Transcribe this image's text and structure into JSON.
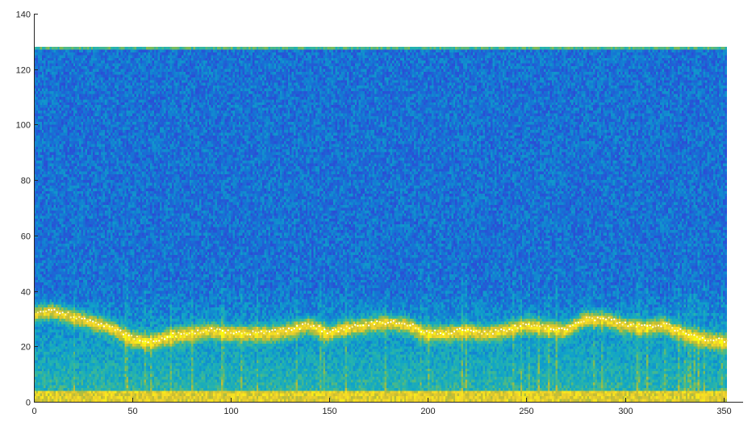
{
  "chart_data": {
    "type": "heatmap",
    "title": "",
    "xlabel": "",
    "ylabel": "",
    "xlim": [
      0,
      360
    ],
    "ylim": [
      0,
      140
    ],
    "grid": false,
    "x_ticks": [
      0,
      50,
      100,
      150,
      200,
      250,
      300,
      350
    ],
    "y_ticks": [
      0,
      20,
      40,
      60,
      80,
      100,
      120,
      140
    ],
    "data_extent": {
      "x": [
        1,
        352
      ],
      "y": [
        1,
        128
      ]
    },
    "colormap": "parula",
    "colormap_stops": [
      "#352a87",
      "#2a4ed6",
      "#1478d4",
      "#10a4c8",
      "#2ab5a8",
      "#7bbd59",
      "#c8bd34",
      "#f4d52a",
      "#f9fb0e"
    ],
    "low_band": {
      "y_range": [
        1,
        4
      ],
      "level": "high"
    },
    "top_edge": {
      "y": 128,
      "level": "medium"
    },
    "ridge": {
      "x": [
        1,
        10,
        20,
        30,
        40,
        50,
        60,
        70,
        80,
        90,
        100,
        110,
        120,
        130,
        140,
        150,
        160,
        170,
        180,
        190,
        200,
        210,
        220,
        230,
        240,
        250,
        260,
        270,
        280,
        290,
        300,
        310,
        320,
        330,
        340,
        350
      ],
      "y": [
        32,
        33,
        31,
        29,
        27,
        23,
        22,
        24,
        25,
        26,
        25,
        25,
        25,
        26,
        28,
        25,
        27,
        28,
        29,
        28,
        25,
        25,
        26,
        25,
        26,
        28,
        27,
        26,
        30,
        30,
        28,
        27,
        28,
        25,
        23,
        22
      ]
    }
  }
}
